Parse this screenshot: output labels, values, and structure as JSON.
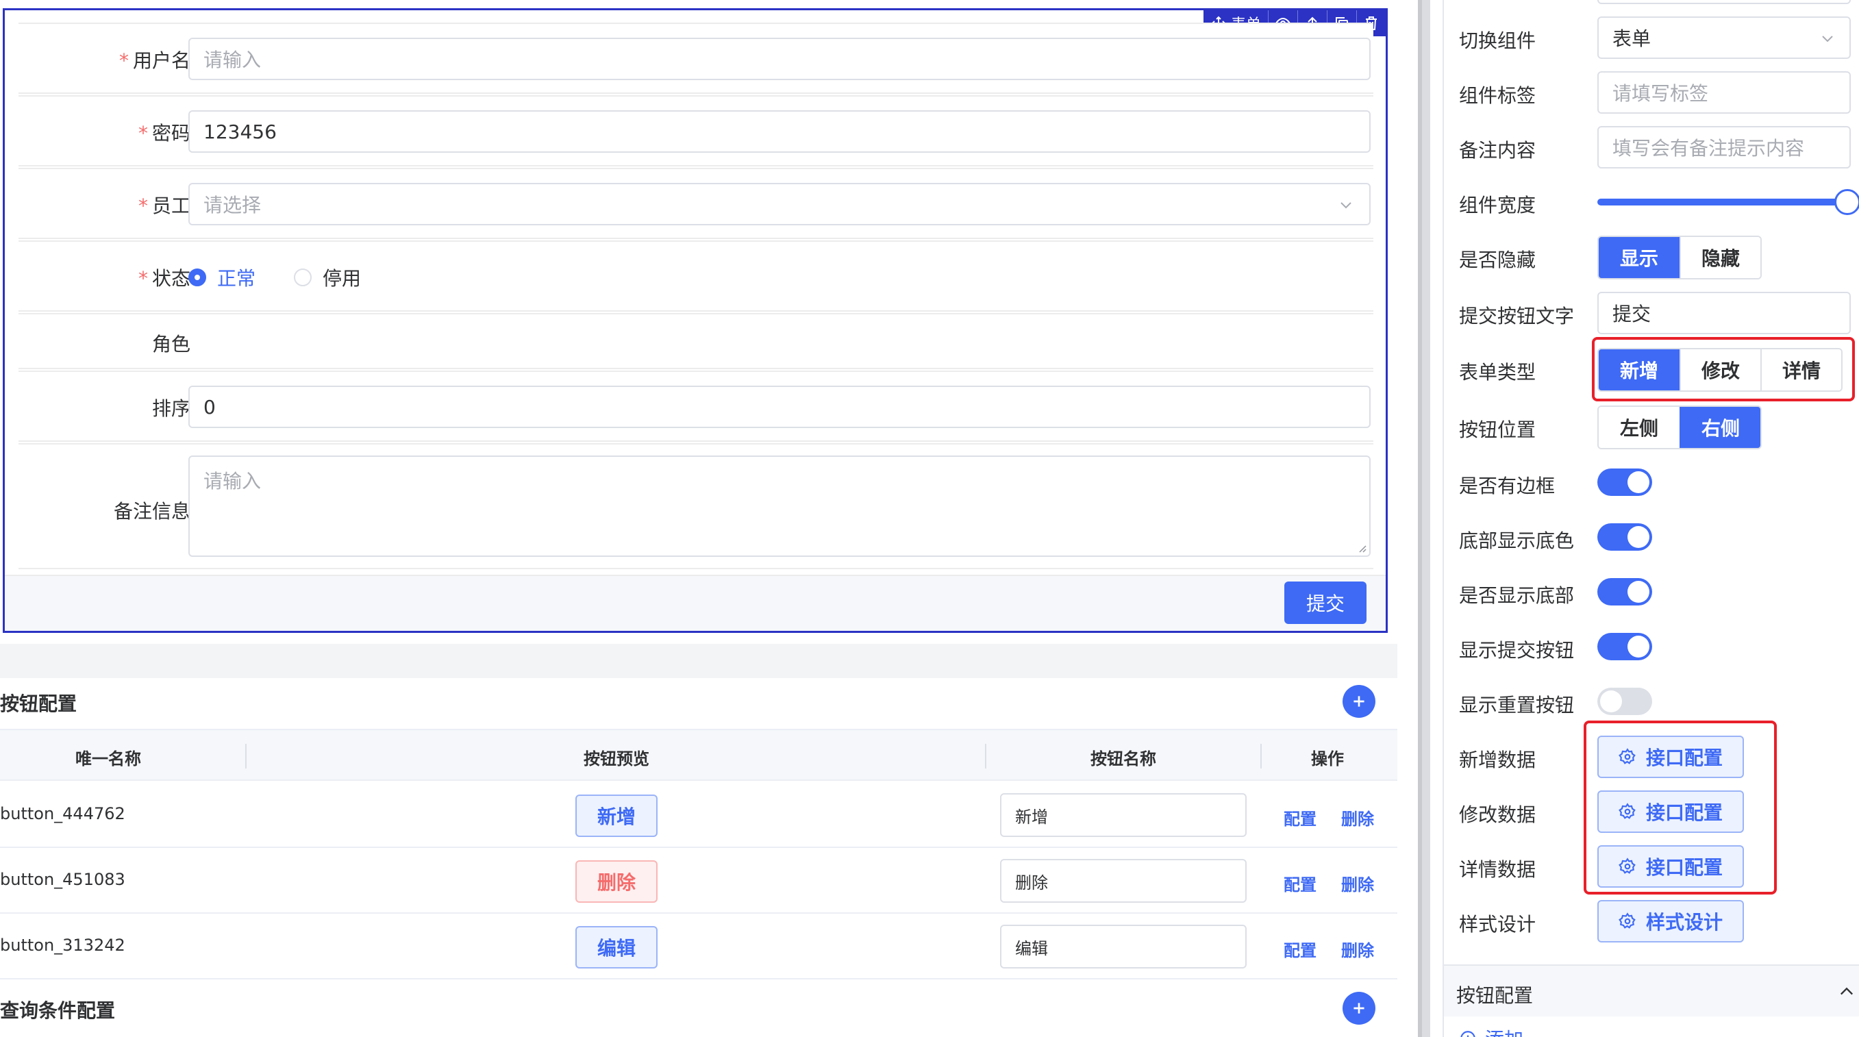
{
  "form": {
    "toolbar": {
      "title": "表单"
    },
    "fields": {
      "username": {
        "label": "用户名",
        "placeholder": "请输入"
      },
      "password": {
        "label": "密码",
        "value": "123456"
      },
      "employee": {
        "label": "员工",
        "placeholder": "请选择"
      },
      "status": {
        "label": "状态",
        "options": [
          "正常",
          "停用"
        ],
        "selected": "正常"
      },
      "role": {
        "label": "角色"
      },
      "sort": {
        "label": "排序",
        "value": "0"
      },
      "remark": {
        "label": "备注信息",
        "placeholder": "请输入"
      }
    },
    "required_mark": "*",
    "submit_label": "提交"
  },
  "button_config": {
    "title": "按钮配置",
    "columns": [
      "唯一名称",
      "按钮预览",
      "按钮名称",
      "操作"
    ],
    "rows": [
      {
        "id": "button_444762",
        "preview": "新增",
        "name": "新增",
        "style": "primary"
      },
      {
        "id": "button_451083",
        "preview": "删除",
        "name": "删除",
        "style": "danger"
      },
      {
        "id": "button_313242",
        "preview": "编辑",
        "name": "编辑",
        "style": "primary"
      }
    ],
    "actions": {
      "config": "配置",
      "delete": "删除"
    }
  },
  "query_config": {
    "title": "查询条件配置"
  },
  "panel": {
    "switch_component": {
      "label": "切换组件",
      "value": "表单"
    },
    "component_label": {
      "label": "组件标签",
      "placeholder": "请填写标签"
    },
    "remark_content": {
      "label": "备注内容",
      "placeholder": "填写会有备注提示内容"
    },
    "component_width": {
      "label": "组件宽度",
      "value": 100
    },
    "hidden": {
      "label": "是否隐藏",
      "options": [
        "显示",
        "隐藏"
      ],
      "selected": "显示"
    },
    "submit_text": {
      "label": "提交按钮文字",
      "value": "提交"
    },
    "form_type": {
      "label": "表单类型",
      "options": [
        "新增",
        "修改",
        "详情"
      ],
      "selected": "新增"
    },
    "button_position": {
      "label": "按钮位置",
      "options": [
        "左侧",
        "右侧"
      ],
      "selected": "右侧"
    },
    "toggles": [
      {
        "label": "是否有边框",
        "on": true
      },
      {
        "label": "底部显示底色",
        "on": true
      },
      {
        "label": "是否显示底部",
        "on": true
      },
      {
        "label": "显示提交按钮",
        "on": true
      },
      {
        "label": "显示重置按钮",
        "on": false
      }
    ],
    "api": [
      {
        "label": "新增数据",
        "button": "接口配置"
      },
      {
        "label": "修改数据",
        "button": "接口配置"
      },
      {
        "label": "详情数据",
        "button": "接口配置"
      }
    ],
    "style_design": {
      "label": "样式设计",
      "button": "样式设计"
    },
    "collapse": {
      "title": "按钮配置"
    },
    "add_link": "添加"
  },
  "colors": {
    "primary": "#3e6af5",
    "danger": "#f56c6c",
    "selection": "#2b32c4",
    "highlight": "#e8202a"
  }
}
